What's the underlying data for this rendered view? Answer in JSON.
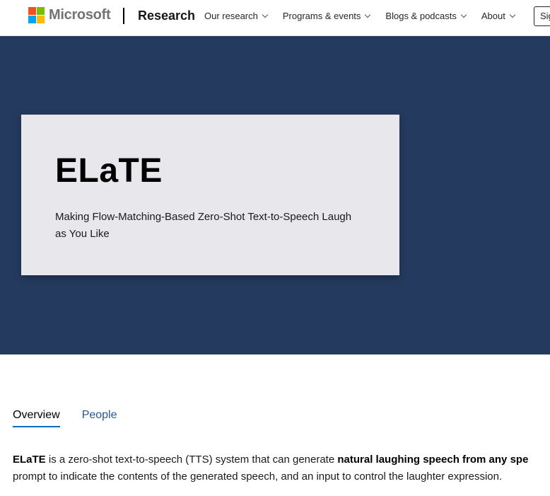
{
  "header": {
    "brand": "Microsoft",
    "site": "Research",
    "nav": [
      {
        "label": "Our research"
      },
      {
        "label": "Programs & events"
      },
      {
        "label": "Blogs & podcasts"
      },
      {
        "label": "About"
      }
    ],
    "signin_label": "Sig",
    "logo_colors": [
      "#f25022",
      "#7fba00",
      "#00a4ef",
      "#ffb900"
    ]
  },
  "hero": {
    "title": "ELaTE",
    "subtitle": "Making Flow-Matching-Based Zero-Shot Text-to-Speech Laugh as You Like",
    "background_color": "#243a5e"
  },
  "tabs": [
    {
      "label": "Overview",
      "active": true
    },
    {
      "label": "People",
      "active": false
    }
  ],
  "content": {
    "line1_bold1": "ELaTE",
    "line1_text": " is a zero-shot text-to-speech (TTS) system that can generate ",
    "line1_bold2": "natural laughing speech from any spe",
    "line2_text": "prompt to indicate the contents of the generated speech, and an input to control the laughter expression."
  }
}
